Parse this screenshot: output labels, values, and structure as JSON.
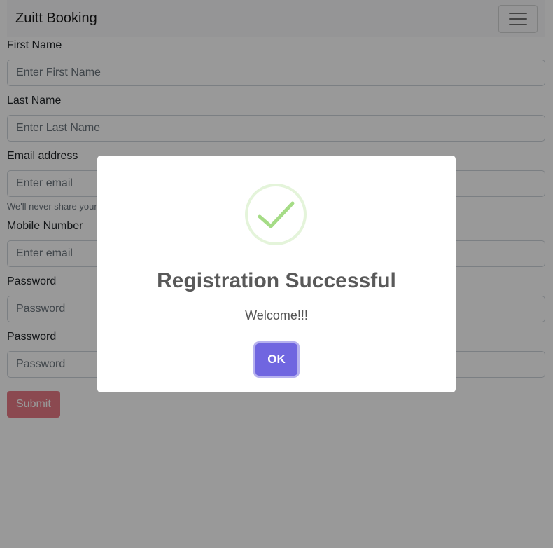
{
  "navbar": {
    "brand": "Zuitt Booking",
    "toggler_icon": "hamburger-menu-icon"
  },
  "form": {
    "first_name": {
      "label": "First Name",
      "placeholder": "Enter First Name"
    },
    "last_name": {
      "label": "Last Name",
      "placeholder": "Enter Last Name"
    },
    "email": {
      "label": "Email address",
      "placeholder": "Enter email",
      "help": "We'll never share your email with anyone else."
    },
    "mobile": {
      "label": "Mobile Number",
      "placeholder": "Enter email"
    },
    "password1": {
      "label": "Password",
      "placeholder": "Password"
    },
    "password2": {
      "label": "Password",
      "placeholder": "Password"
    },
    "submit_label": "Submit"
  },
  "dialog": {
    "icon": "success-check-icon",
    "title": "Registration Successful",
    "message": "Welcome!!!",
    "ok_label": "OK"
  },
  "colors": {
    "accent": "#7066e0",
    "success": "#a5dc86",
    "danger": "#dc3545"
  }
}
